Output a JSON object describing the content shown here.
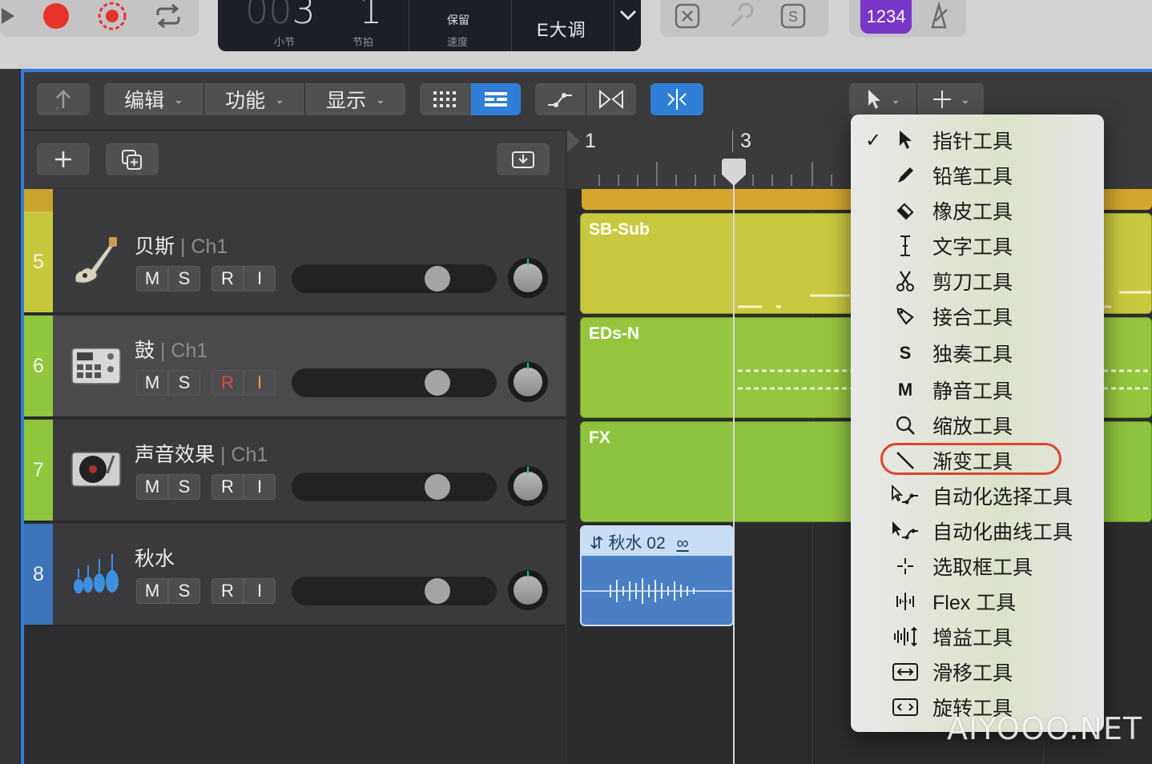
{
  "lcd": {
    "bar_value": "003",
    "beat_value": "1",
    "bar_label": "小节",
    "beat_label": "节拍",
    "tempo_top": "保留",
    "tempo_label": "速度",
    "key": "E大调"
  },
  "count_in": {
    "label": "1234"
  },
  "toolbar": {
    "edit_label": "编辑",
    "function_label": "功能",
    "view_label": "显示"
  },
  "tracks": [
    {
      "number": "5",
      "name": "贝斯",
      "channel": "| Ch1",
      "color": "#c7c93c",
      "icon": "bass-guitar-icon",
      "m": "M",
      "s": "S",
      "r": "R",
      "i": "I",
      "armed": false
    },
    {
      "number": "6",
      "name": "鼓",
      "channel": "| Ch1",
      "color": "#8fc63c",
      "icon": "drum-machine-icon",
      "m": "M",
      "s": "S",
      "r": "R",
      "i": "I",
      "armed": true
    },
    {
      "number": "7",
      "name": "声音效果",
      "channel": "| Ch1",
      "color": "#8fc63c",
      "icon": "turntable-icon",
      "m": "M",
      "s": "S",
      "r": "R",
      "i": "I",
      "armed": false
    },
    {
      "number": "8",
      "name": "秋水",
      "channel": "",
      "color": "#3d73b8",
      "icon": "strings-icon",
      "m": "M",
      "s": "S",
      "r": "R",
      "i": "I",
      "armed": false
    }
  ],
  "ruler": {
    "marks": [
      "1",
      "3"
    ]
  },
  "regions": [
    {
      "name": "SB-Sub",
      "color": "#c9c93f"
    },
    {
      "name": "EDs-N",
      "color": "#95c53d"
    },
    {
      "name": "FX",
      "color": "#8ec33f"
    },
    {
      "name": "秋水 02",
      "color": "#4a7fc4"
    }
  ],
  "tool_menu": {
    "selected": "指针工具",
    "highlighted": "渐变工具",
    "items": [
      {
        "label": "指针工具",
        "icon": "pointer-icon"
      },
      {
        "label": "铅笔工具",
        "icon": "pencil-icon"
      },
      {
        "label": "橡皮工具",
        "icon": "eraser-icon"
      },
      {
        "label": "文字工具",
        "icon": "text-cursor-icon"
      },
      {
        "label": "剪刀工具",
        "icon": "scissors-icon"
      },
      {
        "label": "接合工具",
        "icon": "glue-icon"
      },
      {
        "label": "独奏工具",
        "icon": "solo-icon",
        "glyph": "S"
      },
      {
        "label": "静音工具",
        "icon": "mute-icon",
        "glyph": "M"
      },
      {
        "label": "缩放工具",
        "icon": "zoom-icon"
      },
      {
        "label": "渐变工具",
        "icon": "fade-icon"
      },
      {
        "label": "自动化选择工具",
        "icon": "automation-select-icon"
      },
      {
        "label": "自动化曲线工具",
        "icon": "automation-curve-icon"
      },
      {
        "label": "选取框工具",
        "icon": "marquee-icon"
      },
      {
        "label": "Flex 工具",
        "icon": "flex-icon"
      },
      {
        "label": "增益工具",
        "icon": "gain-icon"
      },
      {
        "label": "滑移工具",
        "icon": "slip-icon"
      },
      {
        "label": "旋转工具",
        "icon": "rotate-icon"
      }
    ]
  },
  "watermark": "AIYOOO.NET"
}
